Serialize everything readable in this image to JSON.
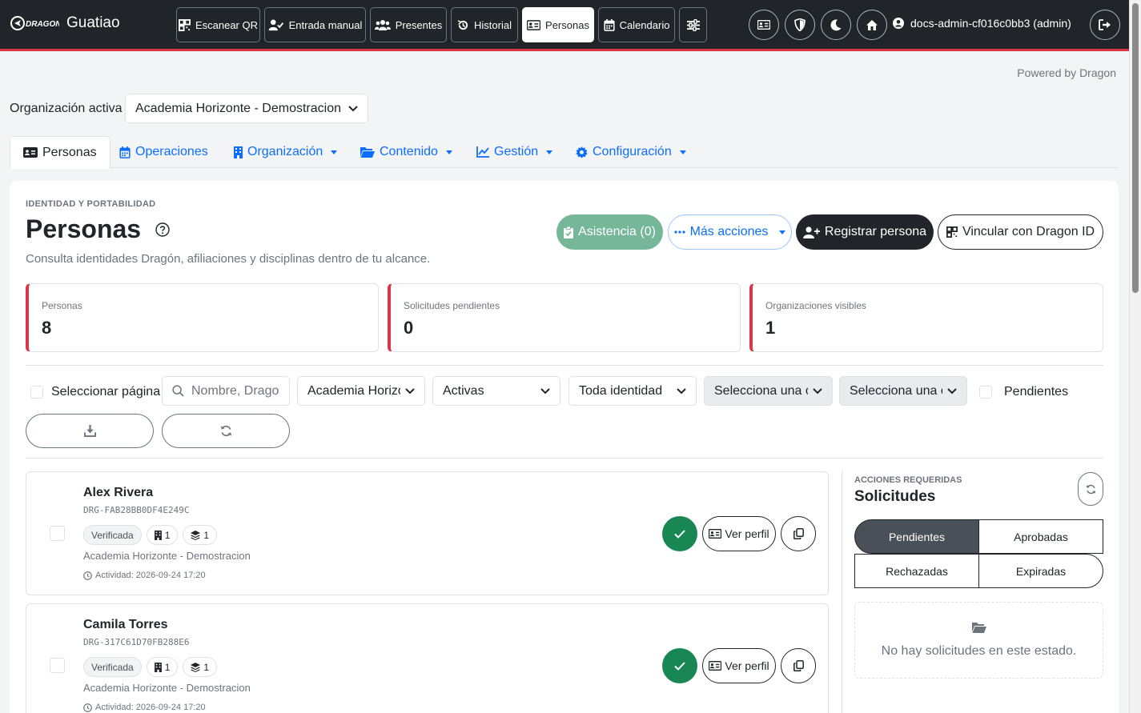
{
  "brand": {
    "logo_text": "DRAGON",
    "name": "Guatiao"
  },
  "nav": {
    "items": [
      {
        "label": "Escanear QR",
        "icon": "qr-icon"
      },
      {
        "label": "Entrada manual",
        "icon": "user-check-icon"
      },
      {
        "label": "Presentes",
        "icon": "users-icon"
      },
      {
        "label": "Historial",
        "icon": "history-icon"
      },
      {
        "label": "Personas",
        "icon": "id-card-icon",
        "active": true
      },
      {
        "label": "Calendario",
        "icon": "calendar-icon"
      }
    ],
    "user": "docs-admin-cf016c0bb3 (admin)"
  },
  "powered_by": "Powered by Dragon",
  "org": {
    "label": "Organización activa",
    "selected": "Academia Horizonte - Demostracion"
  },
  "tabs": [
    {
      "label": "Personas",
      "active": true
    },
    {
      "label": "Operaciones"
    },
    {
      "label": "Organización"
    },
    {
      "label": "Contenido"
    },
    {
      "label": "Gestión"
    },
    {
      "label": "Configuración"
    }
  ],
  "page": {
    "eyebrow": "IDENTIDAD Y PORTABILIDAD",
    "title": "Personas",
    "subtitle": "Consulta identidades Dragón, afiliaciones y disciplinas dentro de tu alcance.",
    "actions": {
      "attendance": "Asistencia (0)",
      "more": "Más acciones",
      "register": "Registrar persona",
      "link": "Vincular con Dragon ID"
    }
  },
  "stats": [
    {
      "label": "Personas",
      "value": "8"
    },
    {
      "label": "Solicitudes pendientes",
      "value": "0"
    },
    {
      "label": "Organizaciones visibles",
      "value": "1"
    }
  ],
  "filters": {
    "select_page": "Seleccionar página",
    "search_placeholder": "Nombre, Dragon ID",
    "org": "Academia Horizonte - Demostracion",
    "status": "Activas",
    "identity": "Toda identidad",
    "select_a": "Selecciona una opción",
    "select_b": "Selecciona una opción",
    "pending": "Pendientes"
  },
  "people": [
    {
      "name": "Alex Rivera",
      "id": "DRG-FAB28BB0DF4E249C",
      "badge": "Verificada",
      "orgs": "1",
      "disciplines": "1",
      "org": "Academia Horizonte - Demostracion",
      "activity": "Actividad: 2026-09-24 17:20",
      "profile": "Ver perfil"
    },
    {
      "name": "Camila Torres",
      "id": "DRG-317C61D70FB288E6",
      "badge": "Verificada",
      "orgs": "1",
      "disciplines": "1",
      "org": "Academia Horizonte - Demostracion",
      "activity": "Actividad: 2026-09-24 17:20",
      "profile": "Ver perfil"
    }
  ],
  "requests": {
    "eyebrow": "ACCIONES REQUERIDAS",
    "title": "Solicitudes",
    "tabs": [
      "Pendientes",
      "Aprobadas",
      "Rechazadas",
      "Expiradas"
    ],
    "empty": "No hay solicitudes en este estado."
  },
  "colors": {
    "accent_red": "#dc3545",
    "primary": "#0d6efd",
    "success": "#198754",
    "dark": "#212529"
  }
}
